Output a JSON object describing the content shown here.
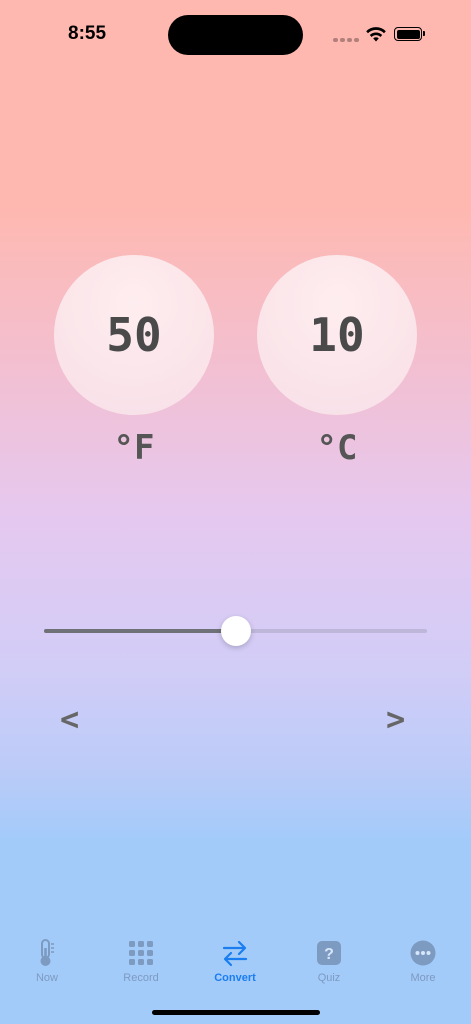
{
  "status": {
    "time": "8:55"
  },
  "converter": {
    "fahrenheit": {
      "value": "50",
      "unit": "°F"
    },
    "celsius": {
      "value": "10",
      "unit": "°C"
    },
    "slider": {
      "fraction": 0.5
    }
  },
  "nav": {
    "prev": "<",
    "next": ">"
  },
  "tabs": [
    {
      "label": "Now",
      "icon": "thermometer-icon",
      "active": false
    },
    {
      "label": "Record",
      "icon": "grid-icon",
      "active": false
    },
    {
      "label": "Convert",
      "icon": "arrows-swap-icon",
      "active": true
    },
    {
      "label": "Quiz",
      "icon": "question-icon",
      "active": false
    },
    {
      "label": "More",
      "icon": "ellipsis-circle-icon",
      "active": false
    }
  ],
  "colors": {
    "accent": "#1a7ef0",
    "inactive": "#7d9ac0"
  }
}
